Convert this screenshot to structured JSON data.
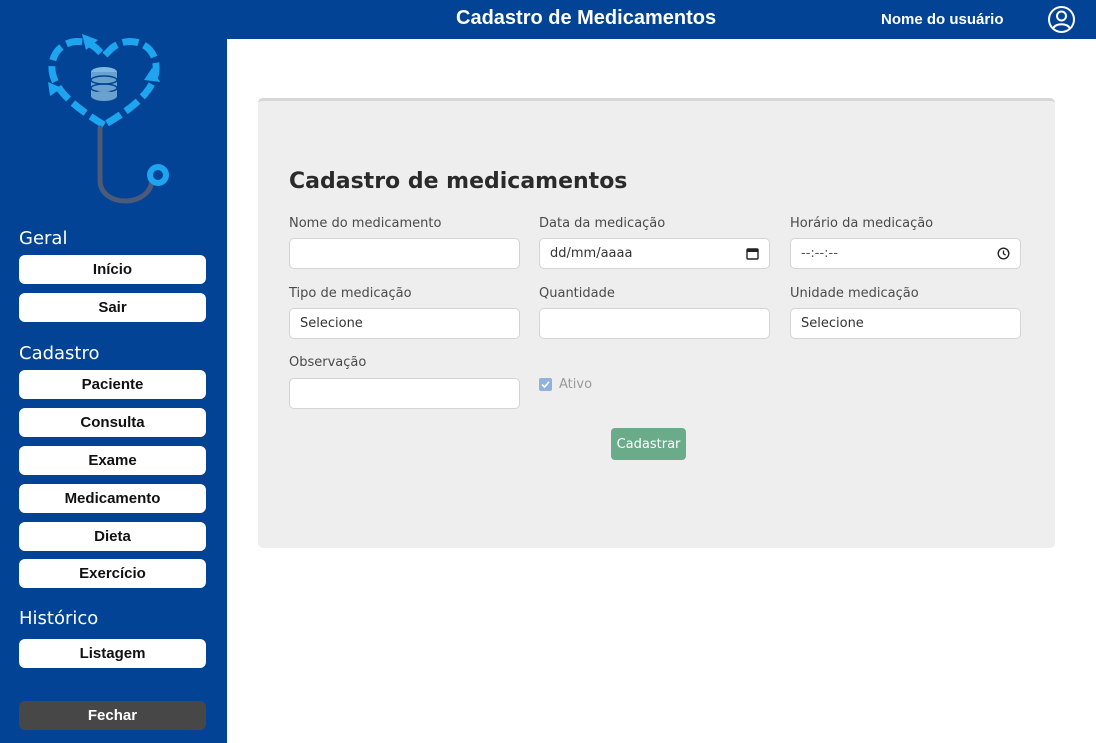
{
  "header": {
    "title": "Cadastro de Medicamentos",
    "user_name": "Nome do usuário",
    "avatar_icon": "user-circle-icon"
  },
  "sidebar": {
    "logo_icon": "stethoscope-heart-database-icon",
    "sections": [
      {
        "title": "Geral",
        "items": [
          "Início",
          "Sair"
        ]
      },
      {
        "title": "Cadastro",
        "items": [
          "Paciente",
          "Consulta",
          "Exame",
          "Medicamento",
          "Dieta",
          "Exercício"
        ]
      },
      {
        "title": "Histórico",
        "items": [
          "Listagem"
        ]
      }
    ],
    "close_label": "Fechar"
  },
  "form": {
    "title": "Cadastro de medicamentos",
    "fields": {
      "nome": {
        "label": "Nome do medicamento",
        "value": ""
      },
      "data": {
        "label": "Data da medicação",
        "placeholder": "dd/mm/aaaa",
        "icon": "calendar-icon"
      },
      "horario": {
        "label": "Horário da medicação",
        "placeholder": "--:--:--",
        "icon": "clock-icon"
      },
      "tipo": {
        "label": "Tipo de medicação",
        "selected": "Selecione"
      },
      "quantidade": {
        "label": "Quantidade",
        "value": ""
      },
      "unidade": {
        "label": "Unidade medicação",
        "selected": "Selecione"
      },
      "observacao": {
        "label": "Observação",
        "value": ""
      }
    },
    "ativo": {
      "label": "Ativo",
      "checked": true
    },
    "submit_label": "Cadastrar"
  },
  "colors": {
    "primary": "#024395",
    "card_bg": "#eeeeee",
    "submit": "#6aab8a",
    "close_button": "#474747",
    "logo_accent": "#1ea5f0"
  }
}
